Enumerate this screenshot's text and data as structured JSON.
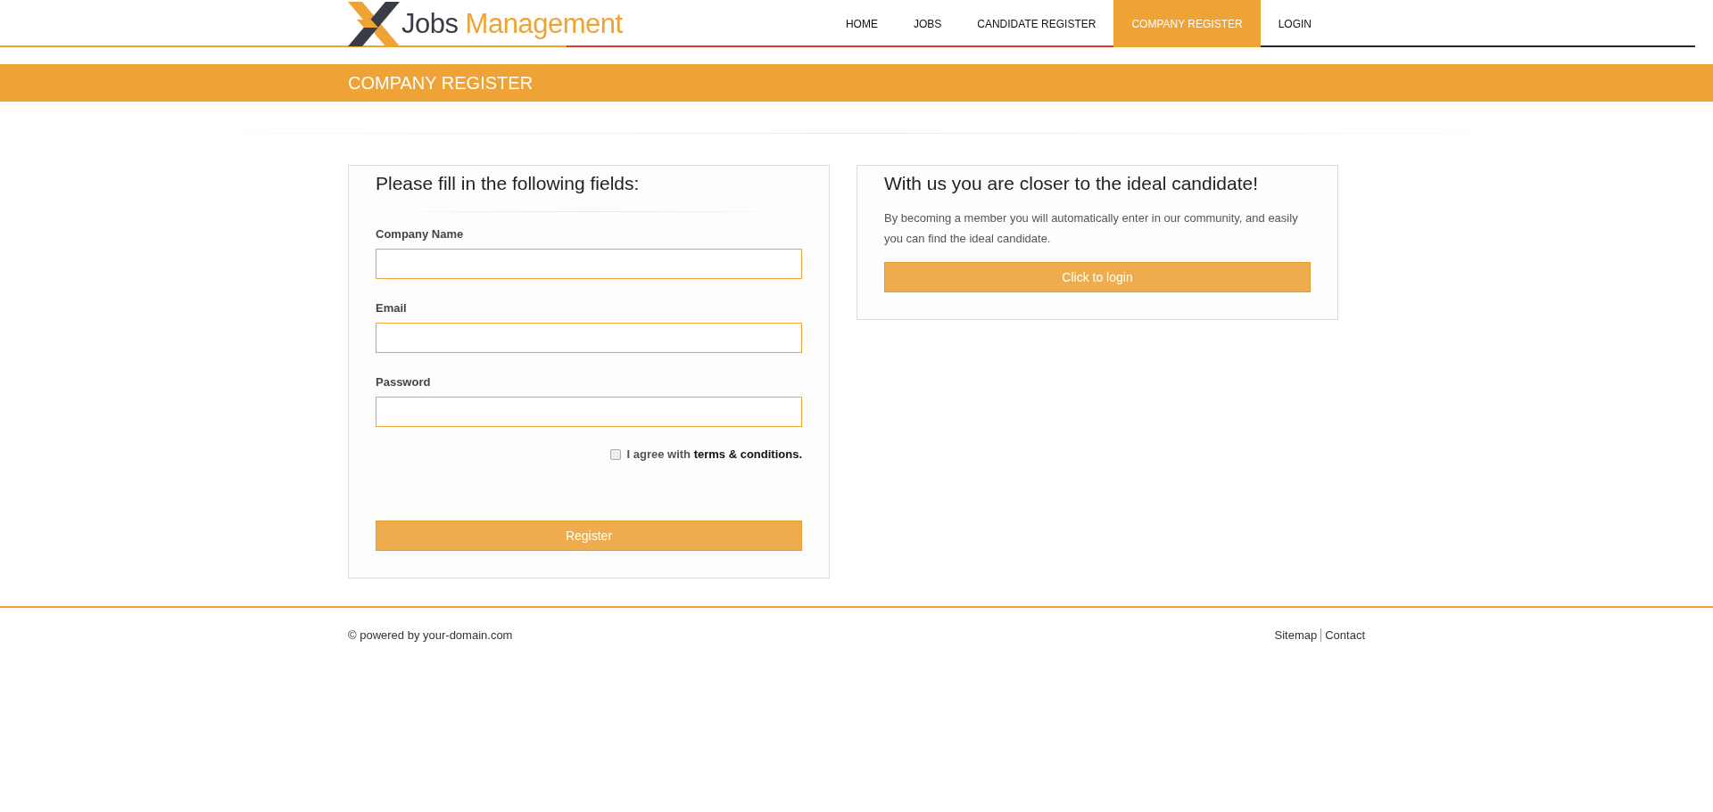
{
  "logo": {
    "text": "Jobs",
    "accent": "Management"
  },
  "nav": [
    {
      "label": "HOME",
      "selected": false
    },
    {
      "label": "JOBS",
      "selected": false
    },
    {
      "label": "CANDIDATE REGISTER",
      "selected": false
    },
    {
      "label": "COMPANY REGISTER",
      "selected": true
    },
    {
      "label": "LOGIN",
      "selected": false
    }
  ],
  "page_title": "COMPANY REGISTER",
  "form": {
    "title": "Please fill in the following fields:",
    "fields": [
      {
        "label": "Company Name"
      },
      {
        "label": "Email"
      },
      {
        "label": "Password"
      }
    ],
    "agree": {
      "text": "I agree with **terms & conditions.**",
      "checked": false
    },
    "button": "Register"
  },
  "promo": {
    "title": "With us you are closer to the ideal candidate!",
    "text": "By becoming a member you will automatically enter in our community, and easily you can find the ideal candidate.",
    "button": "Click to login"
  },
  "footer": {
    "copyright": "© powered by your-domain.com",
    "links": [
      "Sitemap",
      "Contact"
    ]
  }
}
